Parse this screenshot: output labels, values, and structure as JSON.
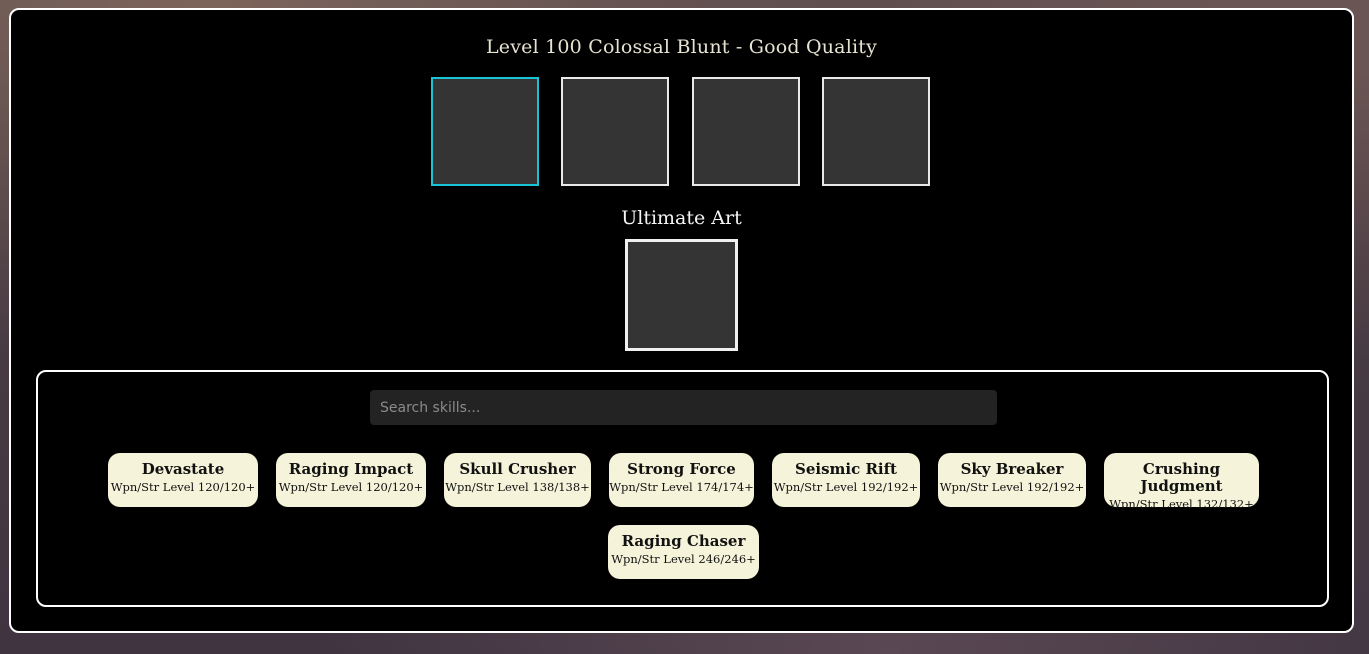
{
  "weapon": {
    "title": "Level 100 Colossal Blunt - Good Quality"
  },
  "art_slots": [
    {
      "label": "Art slot 1",
      "selected": true
    },
    {
      "label": "Art slot 2",
      "selected": false
    },
    {
      "label": "Art slot 3",
      "selected": false
    },
    {
      "label": "Art slot 4",
      "selected": false
    }
  ],
  "ultimate": {
    "label": "Ultimate Art"
  },
  "search": {
    "placeholder": "Search skills..."
  },
  "skills": [
    {
      "name": "Devastate",
      "requirement": "Wpn/Str Level 120/120+"
    },
    {
      "name": "Raging Impact",
      "requirement": "Wpn/Str Level 120/120+"
    },
    {
      "name": "Skull Crusher",
      "requirement": "Wpn/Str Level 138/138+"
    },
    {
      "name": "Strong Force",
      "requirement": "Wpn/Str Level 174/174+"
    },
    {
      "name": "Seismic Rift",
      "requirement": "Wpn/Str Level 192/192+"
    },
    {
      "name": "Sky Breaker",
      "requirement": "Wpn/Str Level 192/192+"
    },
    {
      "name": "Crushing Judgment",
      "requirement": "Wpn/Str Level 132/132+"
    },
    {
      "name": "Raging Chaser",
      "requirement": "Wpn/Str Level 246/246+"
    }
  ],
  "colors": {
    "selected_slot_border": "#19c5d4",
    "slot_fill": "#343434",
    "skill_card_bg": "#f5f3d9"
  }
}
